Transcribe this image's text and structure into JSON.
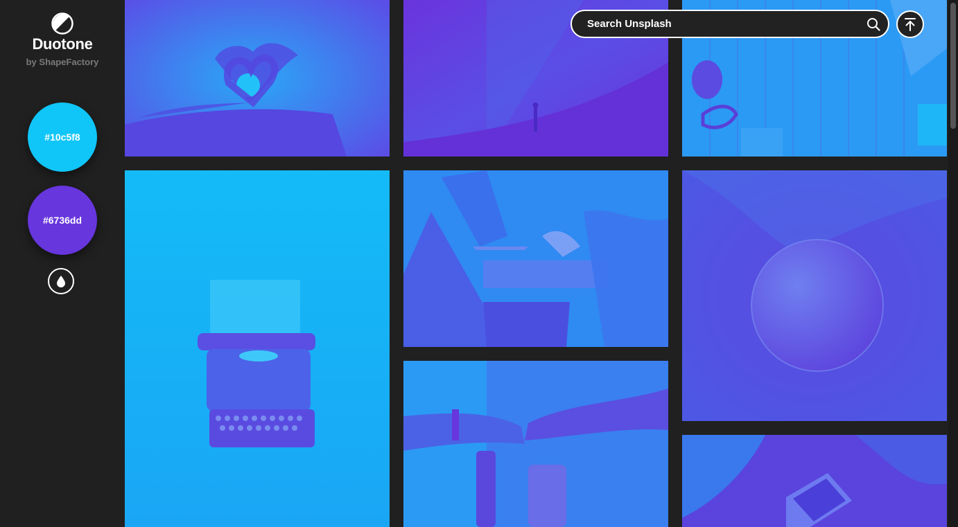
{
  "app": {
    "title": "Duotone",
    "subtitle": "by ShapeFactory"
  },
  "colors": {
    "highlight": {
      "hex": "#10c5f8",
      "label": "#10c5f8"
    },
    "shadow": {
      "hex": "#6736dd",
      "label": "#6736dd"
    }
  },
  "search": {
    "placeholder": "Search Unsplash",
    "value": ""
  },
  "icons": {
    "logo": "half-circle-logo-icon",
    "drop": "water-drop-icon",
    "search": "search-icon",
    "upload": "upload-icon"
  },
  "gallery": [
    {
      "subject": "heart-hands-sunset"
    },
    {
      "subject": "person-under-milky-way"
    },
    {
      "subject": "wooden-desk-top-view"
    },
    {
      "subject": "vintage-typewriter"
    },
    {
      "subject": "laptops-meeting"
    },
    {
      "subject": "planet-in-space"
    },
    {
      "subject": "fist-bump-team"
    },
    {
      "subject": "tablet-on-lap"
    }
  ]
}
